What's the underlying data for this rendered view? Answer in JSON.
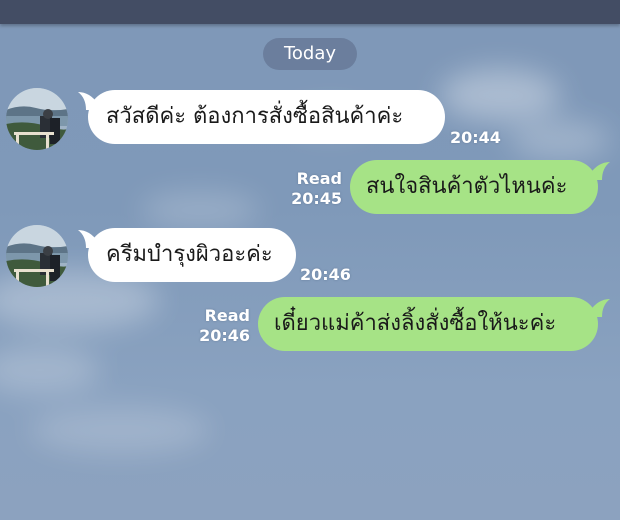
{
  "header": {
    "date_label": "Today"
  },
  "messages": [
    {
      "direction": "incoming",
      "text": "สวัสดีค่ะ ต้องการสั่งซื้อสินค้าค่ะ",
      "time": "20:44"
    },
    {
      "direction": "outgoing",
      "text": "สนใจสินค้าตัวไหนค่ะ",
      "status": "Read",
      "time": "20:45"
    },
    {
      "direction": "incoming",
      "text": "ครีมบำรุงผิวอะค่ะ",
      "time": "20:46"
    },
    {
      "direction": "outgoing",
      "text": "เดี๋ยวแม่ค้าส่งลิ้งสั่งซื้อให้นะค่ะ",
      "status": "Read",
      "time": "20:46"
    }
  ],
  "colors": {
    "background": "#7f98b8",
    "incoming_bubble": "#ffffff",
    "outgoing_bubble": "#a6e386",
    "top_bar": "#434d64"
  }
}
